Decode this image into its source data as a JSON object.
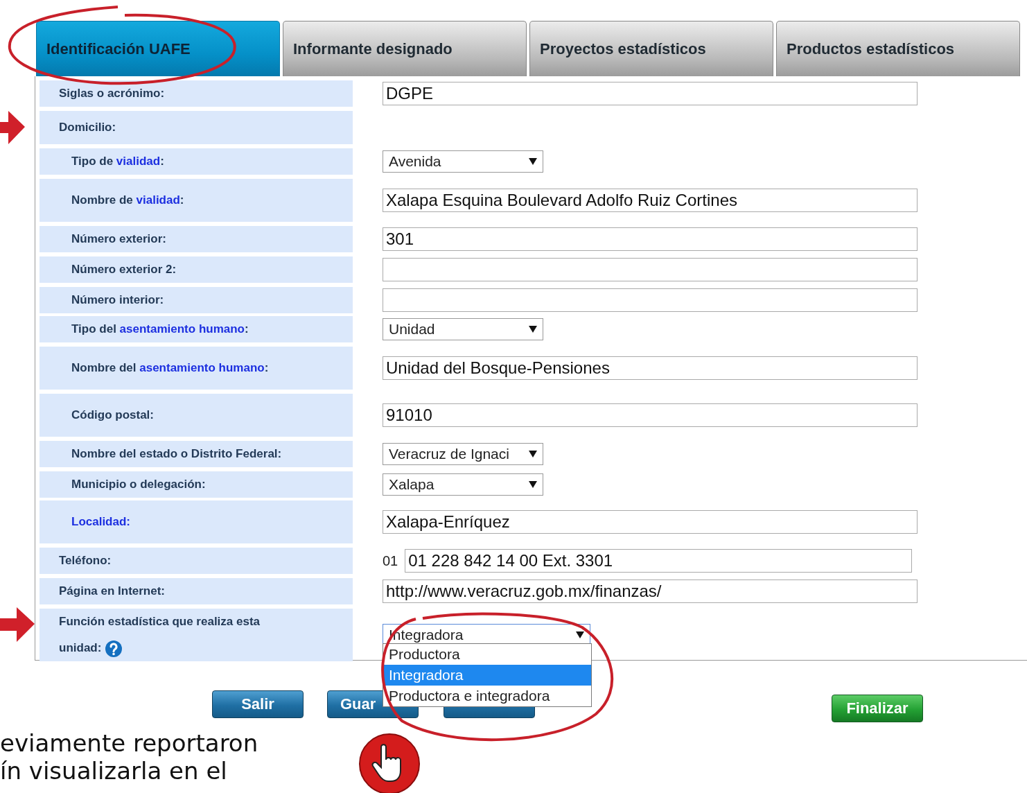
{
  "tabs": [
    {
      "label": "Identificación UAFE",
      "selected": true
    },
    {
      "label": "Informante designado",
      "selected": false
    },
    {
      "label": "Proyectos estadísticos",
      "selected": false
    },
    {
      "label": "Productos estadísticos",
      "selected": false
    }
  ],
  "form_rows": [
    {
      "label": [
        {
          "text": "Siglas o acrónimo:"
        }
      ],
      "indent": false,
      "field": {
        "kind": "text",
        "value": "DGPE"
      }
    },
    {
      "label": [
        {
          "text": "Domicilio:"
        }
      ],
      "indent": false,
      "field": {
        "kind": "none"
      }
    },
    {
      "label": [
        {
          "text": "Tipo de "
        },
        {
          "text": "vialidad",
          "link": true
        },
        {
          "text": ":"
        }
      ],
      "indent": true,
      "field": {
        "kind": "select",
        "value": "Avenida"
      }
    },
    {
      "label": [
        {
          "text": "Nombre de "
        },
        {
          "text": "vialidad",
          "link": true
        },
        {
          "text": ":"
        }
      ],
      "indent": true,
      "field": {
        "kind": "text",
        "value": "Xalapa Esquina Boulevard Adolfo Ruiz Cortines"
      }
    },
    {
      "label": [
        {
          "text": "Número exterior:"
        }
      ],
      "indent": true,
      "field": {
        "kind": "text",
        "value": "301"
      }
    },
    {
      "label": [
        {
          "text": "Número exterior 2:"
        }
      ],
      "indent": true,
      "field": {
        "kind": "text"
      }
    },
    {
      "label": [
        {
          "text": "Número interior:"
        }
      ],
      "indent": true,
      "field": {
        "kind": "text"
      }
    },
    {
      "label": [
        {
          "text": "Tipo del "
        },
        {
          "text": "asentamiento humano",
          "link": true
        },
        {
          "text": ":"
        }
      ],
      "indent": true,
      "field": {
        "kind": "select",
        "value": "Unidad"
      }
    },
    {
      "label": [
        {
          "text": "Nombre del "
        },
        {
          "text": "asentamiento humano",
          "link": true
        },
        {
          "text": ":"
        }
      ],
      "indent": true,
      "field": {
        "kind": "text",
        "value": "Unidad del Bosque-Pensiones"
      }
    },
    {
      "label": [
        {
          "text": "Código postal:"
        }
      ],
      "indent": true,
      "field": {
        "kind": "text",
        "value": "91010"
      }
    },
    {
      "label": [
        {
          "text": "Nombre del estado o Distrito Federal:"
        }
      ],
      "indent": true,
      "field": {
        "kind": "select",
        "value": "Veracruz de Ignaci"
      }
    },
    {
      "label": [
        {
          "text": "Municipio o delegación:"
        }
      ],
      "indent": true,
      "field": {
        "kind": "select",
        "value": "Xalapa"
      }
    },
    {
      "label": [
        {
          "text": "Localidad:",
          "link": true
        }
      ],
      "indent": true,
      "field": {
        "kind": "text",
        "value": "Xalapa-Enríquez"
      }
    },
    {
      "label": [
        {
          "text": "Teléfono:"
        }
      ],
      "indent": false,
      "field": {
        "kind": "phone",
        "prefix": "01",
        "value": "01 228 842 14 00 Ext. 3301"
      }
    },
    {
      "label": [
        {
          "text": "Página en Internet:"
        }
      ],
      "indent": false,
      "field": {
        "kind": "text",
        "value": "http://www.veracruz.gob.mx/finanzas/"
      }
    },
    {
      "label": [
        {
          "text": "Función estadística que realiza esta unidad:"
        }
      ],
      "indent": false,
      "help": true,
      "field": {
        "kind": "open-select",
        "value": "Integradora",
        "options": [
          {
            "label": "Productora",
            "selected": false
          },
          {
            "label": "Integradora",
            "selected": true
          },
          {
            "label": "Productora e integradora",
            "selected": false
          }
        ]
      }
    }
  ],
  "buttons": [
    {
      "label": "Salir",
      "kind": "blue"
    },
    {
      "label": "Guar",
      "kind": "blue"
    },
    {
      "kind": "blue"
    },
    {
      "label": "Finalizar",
      "kind": "green"
    }
  ],
  "background_text": [
    "eviamente reportaron",
    "ín visualizarla en el"
  ]
}
